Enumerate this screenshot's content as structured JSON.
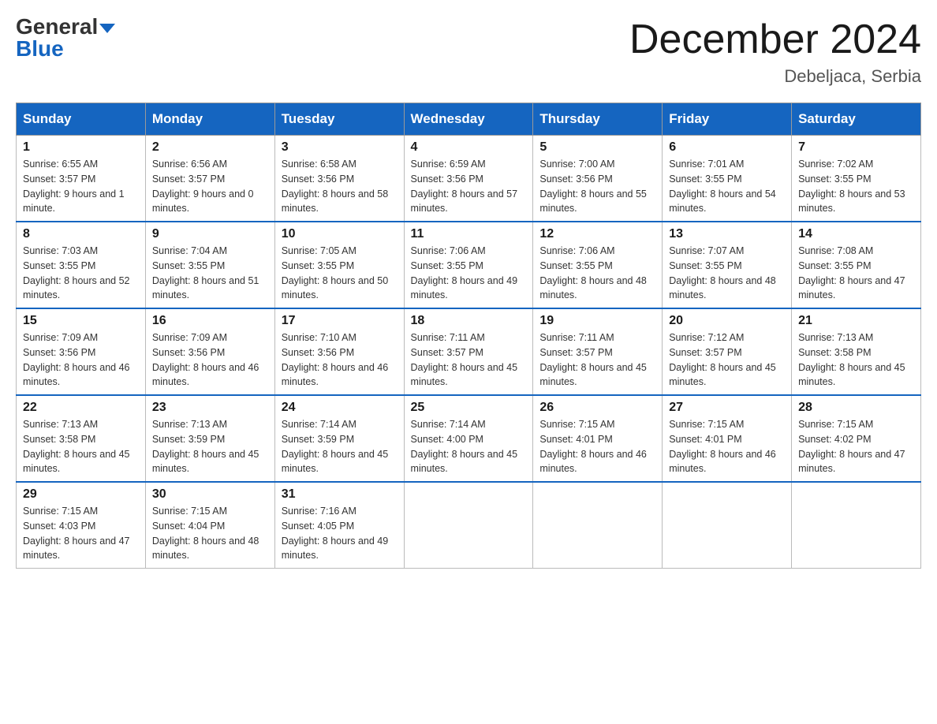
{
  "header": {
    "logo": {
      "general": "General",
      "blue": "Blue"
    },
    "title": "December 2024",
    "location": "Debeljaca, Serbia"
  },
  "days_of_week": [
    "Sunday",
    "Monday",
    "Tuesday",
    "Wednesday",
    "Thursday",
    "Friday",
    "Saturday"
  ],
  "weeks": [
    [
      {
        "day": "1",
        "sunrise": "6:55 AM",
        "sunset": "3:57 PM",
        "daylight": "9 hours and 1 minute."
      },
      {
        "day": "2",
        "sunrise": "6:56 AM",
        "sunset": "3:57 PM",
        "daylight": "9 hours and 0 minutes."
      },
      {
        "day": "3",
        "sunrise": "6:58 AM",
        "sunset": "3:56 PM",
        "daylight": "8 hours and 58 minutes."
      },
      {
        "day": "4",
        "sunrise": "6:59 AM",
        "sunset": "3:56 PM",
        "daylight": "8 hours and 57 minutes."
      },
      {
        "day": "5",
        "sunrise": "7:00 AM",
        "sunset": "3:56 PM",
        "daylight": "8 hours and 55 minutes."
      },
      {
        "day": "6",
        "sunrise": "7:01 AM",
        "sunset": "3:55 PM",
        "daylight": "8 hours and 54 minutes."
      },
      {
        "day": "7",
        "sunrise": "7:02 AM",
        "sunset": "3:55 PM",
        "daylight": "8 hours and 53 minutes."
      }
    ],
    [
      {
        "day": "8",
        "sunrise": "7:03 AM",
        "sunset": "3:55 PM",
        "daylight": "8 hours and 52 minutes."
      },
      {
        "day": "9",
        "sunrise": "7:04 AM",
        "sunset": "3:55 PM",
        "daylight": "8 hours and 51 minutes."
      },
      {
        "day": "10",
        "sunrise": "7:05 AM",
        "sunset": "3:55 PM",
        "daylight": "8 hours and 50 minutes."
      },
      {
        "day": "11",
        "sunrise": "7:06 AM",
        "sunset": "3:55 PM",
        "daylight": "8 hours and 49 minutes."
      },
      {
        "day": "12",
        "sunrise": "7:06 AM",
        "sunset": "3:55 PM",
        "daylight": "8 hours and 48 minutes."
      },
      {
        "day": "13",
        "sunrise": "7:07 AM",
        "sunset": "3:55 PM",
        "daylight": "8 hours and 48 minutes."
      },
      {
        "day": "14",
        "sunrise": "7:08 AM",
        "sunset": "3:55 PM",
        "daylight": "8 hours and 47 minutes."
      }
    ],
    [
      {
        "day": "15",
        "sunrise": "7:09 AM",
        "sunset": "3:56 PM",
        "daylight": "8 hours and 46 minutes."
      },
      {
        "day": "16",
        "sunrise": "7:09 AM",
        "sunset": "3:56 PM",
        "daylight": "8 hours and 46 minutes."
      },
      {
        "day": "17",
        "sunrise": "7:10 AM",
        "sunset": "3:56 PM",
        "daylight": "8 hours and 46 minutes."
      },
      {
        "day": "18",
        "sunrise": "7:11 AM",
        "sunset": "3:57 PM",
        "daylight": "8 hours and 45 minutes."
      },
      {
        "day": "19",
        "sunrise": "7:11 AM",
        "sunset": "3:57 PM",
        "daylight": "8 hours and 45 minutes."
      },
      {
        "day": "20",
        "sunrise": "7:12 AM",
        "sunset": "3:57 PM",
        "daylight": "8 hours and 45 minutes."
      },
      {
        "day": "21",
        "sunrise": "7:13 AM",
        "sunset": "3:58 PM",
        "daylight": "8 hours and 45 minutes."
      }
    ],
    [
      {
        "day": "22",
        "sunrise": "7:13 AM",
        "sunset": "3:58 PM",
        "daylight": "8 hours and 45 minutes."
      },
      {
        "day": "23",
        "sunrise": "7:13 AM",
        "sunset": "3:59 PM",
        "daylight": "8 hours and 45 minutes."
      },
      {
        "day": "24",
        "sunrise": "7:14 AM",
        "sunset": "3:59 PM",
        "daylight": "8 hours and 45 minutes."
      },
      {
        "day": "25",
        "sunrise": "7:14 AM",
        "sunset": "4:00 PM",
        "daylight": "8 hours and 45 minutes."
      },
      {
        "day": "26",
        "sunrise": "7:15 AM",
        "sunset": "4:01 PM",
        "daylight": "8 hours and 46 minutes."
      },
      {
        "day": "27",
        "sunrise": "7:15 AM",
        "sunset": "4:01 PM",
        "daylight": "8 hours and 46 minutes."
      },
      {
        "day": "28",
        "sunrise": "7:15 AM",
        "sunset": "4:02 PM",
        "daylight": "8 hours and 47 minutes."
      }
    ],
    [
      {
        "day": "29",
        "sunrise": "7:15 AM",
        "sunset": "4:03 PM",
        "daylight": "8 hours and 47 minutes."
      },
      {
        "day": "30",
        "sunrise": "7:15 AM",
        "sunset": "4:04 PM",
        "daylight": "8 hours and 48 minutes."
      },
      {
        "day": "31",
        "sunrise": "7:16 AM",
        "sunset": "4:05 PM",
        "daylight": "8 hours and 49 minutes."
      },
      null,
      null,
      null,
      null
    ]
  ]
}
